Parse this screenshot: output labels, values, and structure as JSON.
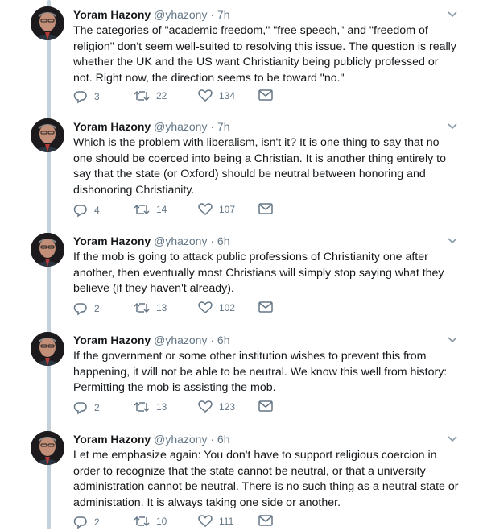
{
  "colors": {
    "name": "#14171a",
    "meta": "#657786",
    "thread_line": "#c4d1da"
  },
  "icons": [
    "reply-icon",
    "retweet-icon",
    "like-icon",
    "message-icon",
    "chevron-down-icon"
  ],
  "tweets": [
    {
      "name": "Yoram Hazony",
      "handle": "@yhazony",
      "dot": "·",
      "time": "7h",
      "text": "The categories of \"academic freedom,\" \"free speech,\" and \"freedom of religion\" don't seem well-suited to resolving this issue. The question is really whether the UK and the US want Christianity being publicly professed or not. Right now, the direction seems to be toward \"no.\"",
      "replies": "3",
      "retweets": "22",
      "likes": "134"
    },
    {
      "name": "Yoram Hazony",
      "handle": "@yhazony",
      "dot": "·",
      "time": "7h",
      "text": "Which is the problem with liberalism, isn't it? It is one thing to say that no one should be coerced into being a Christian. It is another thing entirely to say that the state (or Oxford) should be neutral between honoring and dishonoring Christianity.",
      "replies": "4",
      "retweets": "14",
      "likes": "107"
    },
    {
      "name": "Yoram Hazony",
      "handle": "@yhazony",
      "dot": "·",
      "time": "6h",
      "text": "If the mob is going to attack public professions of Christianity one after another, then eventually most Christians will simply stop saying what they believe (if they haven't already).",
      "replies": "2",
      "retweets": "13",
      "likes": "102"
    },
    {
      "name": "Yoram Hazony",
      "handle": "@yhazony",
      "dot": "·",
      "time": "6h",
      "text": "If the government or some other institution wishes to prevent this from happening, it will not be able to be neutral. We know this well from history: Permitting the mob is assisting the mob.",
      "replies": "2",
      "retweets": "13",
      "likes": "123"
    },
    {
      "name": "Yoram Hazony",
      "handle": "@yhazony",
      "dot": "·",
      "time": "6h",
      "text": "Let me emphasize again: You don't have to support religious coercion in order to recognize that the state cannot be neutral, or that a university administration cannot be neutral. There is no such thing as a neutral state or administation. It is always taking one side or another.",
      "replies": "2",
      "retweets": "10",
      "likes": "111"
    }
  ]
}
